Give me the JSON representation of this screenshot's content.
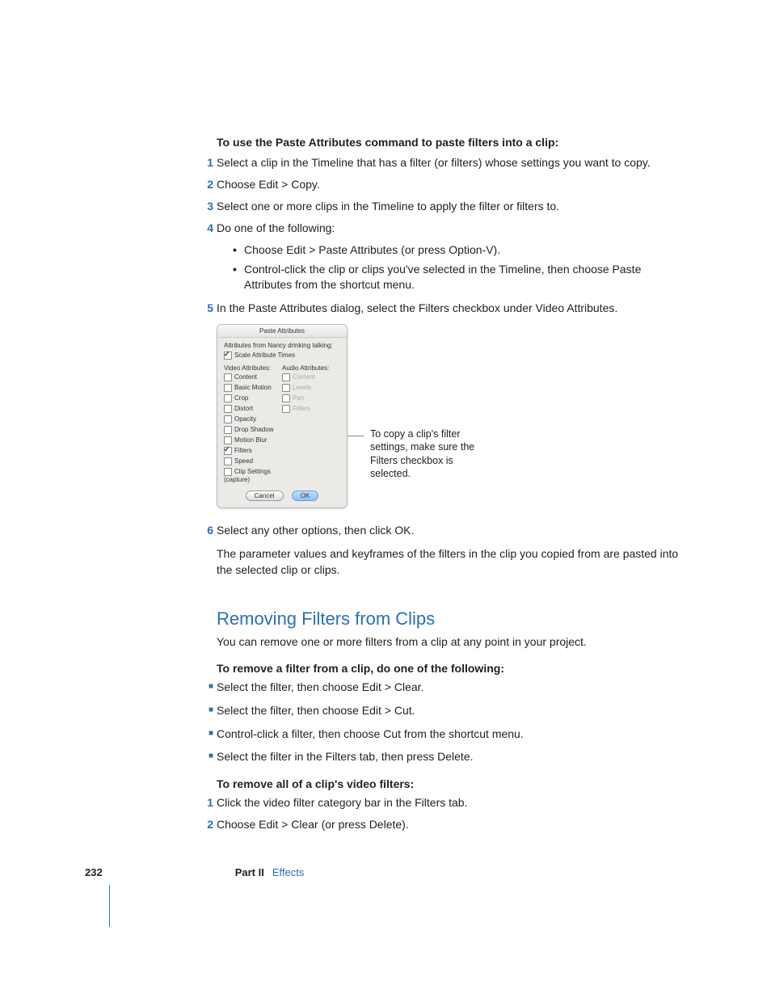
{
  "section1": {
    "heading": "To use the Paste Attributes command to paste filters into a clip:",
    "steps": [
      "Select a clip in the Timeline that has a filter (or filters) whose settings you want to copy.",
      "Choose Edit > Copy.",
      "Select one or more clips in the Timeline to apply the filter or filters to.",
      "Do one of the following:"
    ],
    "substeps4": [
      "Choose Edit > Paste Attributes (or press Option-V).",
      "Control-click the clip or clips you've selected in the Timeline, then choose Paste Attributes from the shortcut menu."
    ],
    "step5": "In the Paste Attributes dialog, select the Filters checkbox under Video Attributes.",
    "step6": "Select any other options, then click OK.",
    "result": "The parameter values and keyframes of the filters in the clip you copied from are pasted into the selected clip or clips."
  },
  "dialog": {
    "title": "Paste Attributes",
    "from": "Attributes from Nancy drinking talking:",
    "scale": "Scale Attribute Times",
    "video_label": "Video Attributes:",
    "audio_label": "Audio Attributes:",
    "video_opts": [
      "Content",
      "Basic Motion",
      "Crop",
      "Distort",
      "Opacity",
      "Drop Shadow",
      "Motion Blur",
      "Filters",
      "Speed",
      "Clip Settings (capture)"
    ],
    "video_checked_index": 7,
    "audio_opts": [
      "Content",
      "Levels",
      "Pan",
      "Filters"
    ],
    "cancel": "Cancel",
    "ok": "OK",
    "callout": "To copy a clip's filter settings, make sure the Filters checkbox is selected."
  },
  "section2": {
    "title": "Removing Filters from Clips",
    "intro": "You can remove one or more filters from a clip at any point in your project.",
    "sub1_heading": "To remove a filter from a clip, do one of the following:",
    "sub1_items": [
      "Select the filter, then choose Edit > Clear.",
      "Select the filter, then choose Edit > Cut.",
      "Control-click a filter, then choose Cut from the shortcut menu.",
      "Select the filter in the Filters tab, then press Delete."
    ],
    "sub2_heading": "To remove all of a clip's video filters:",
    "sub2_steps": [
      "Click the video filter category bar in the Filters tab.",
      "Choose Edit > Clear (or press Delete)."
    ]
  },
  "footer": {
    "page": "232",
    "part": "Part II",
    "section": "Effects"
  }
}
